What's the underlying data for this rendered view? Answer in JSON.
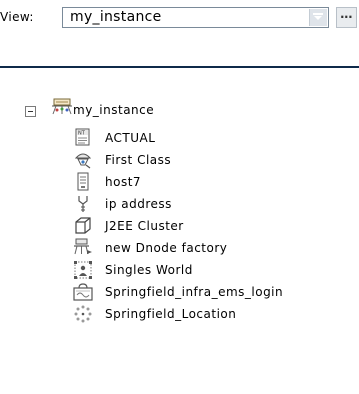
{
  "view": {
    "label": "View:",
    "selected": "my_instance",
    "more_label": "..."
  },
  "tree": {
    "root": {
      "label": "my_instance",
      "icon": "instance-icon",
      "expanded": true
    },
    "items": [
      {
        "label": "ACTUAL",
        "icon": "nt-document-icon"
      },
      {
        "label": "First Class",
        "icon": "class-hat-icon"
      },
      {
        "label": "host7",
        "icon": "host-server-icon"
      },
      {
        "label": "ip address",
        "icon": "ip-address-icon"
      },
      {
        "label": "J2EE Cluster",
        "icon": "cube-cluster-icon"
      },
      {
        "label": "new Dnode factory",
        "icon": "dnode-factory-icon"
      },
      {
        "label": "Singles World",
        "icon": "singles-world-icon"
      },
      {
        "label": "Springfield_infra_ems_login",
        "icon": "ems-login-icon"
      },
      {
        "label": "Springfield_Location",
        "icon": "location-dots-icon"
      }
    ]
  }
}
